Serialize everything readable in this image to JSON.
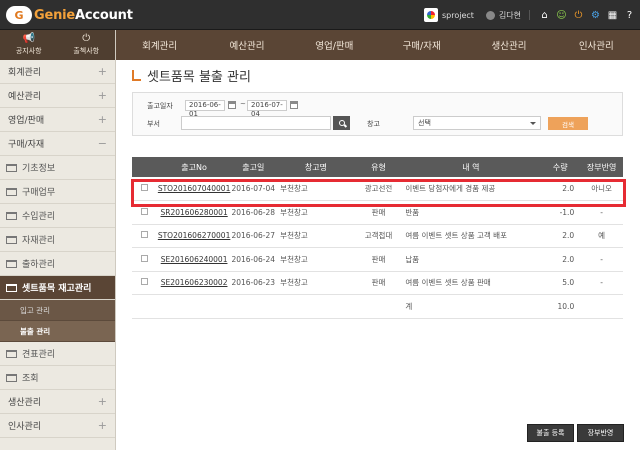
{
  "app": {
    "logo_mark": "G",
    "logo_prefix": "Genie",
    "logo_suffix": "Account"
  },
  "topbar": {
    "company": "sproject",
    "user": "김다현",
    "icons": [
      "home-icon",
      "user-icon",
      "power-icon",
      "gear-icon",
      "calendar-icon",
      "help-icon"
    ]
  },
  "sidebar": {
    "top_buttons": [
      {
        "label": "공지사항",
        "icon": "megaphone-icon"
      },
      {
        "label": "출첵사항",
        "icon": "power-icon"
      }
    ],
    "menu": [
      {
        "label": "회계관리",
        "toggle": "+"
      },
      {
        "label": "예산관리",
        "toggle": "+"
      },
      {
        "label": "영업/판매",
        "toggle": "+"
      },
      {
        "label": "구매/자재",
        "toggle": "−"
      }
    ],
    "submenu": [
      "기초정보",
      "구매업무",
      "수입관리",
      "자재관리",
      "출하관리"
    ],
    "active_submenu": "셋트품목 재고관리",
    "leaves": [
      "입고 관리",
      "불출 관리"
    ],
    "submenu_after": [
      "견표관리",
      "조회"
    ],
    "menu_after": [
      {
        "label": "생산관리",
        "toggle": "+"
      },
      {
        "label": "인사관리",
        "toggle": "+"
      }
    ]
  },
  "topnav": [
    "회계관리",
    "예산관리",
    "영업/판매",
    "구매/자재",
    "생산관리",
    "인사관리"
  ],
  "page": {
    "title": "셋트품목 불출 관리"
  },
  "search": {
    "date_label": "출고일자",
    "date_from": "2016-06-01",
    "date_sep": "~",
    "date_to": "2016-07-04",
    "dept_label": "부서",
    "dept_value": "",
    "warehouse_label": "창고",
    "warehouse_value": "선택",
    "search_button": "검색"
  },
  "table": {
    "headers": [
      "",
      "출고No",
      "출고일",
      "창고명",
      "유형",
      "내 역",
      "수량",
      "장부반영"
    ],
    "rows": [
      {
        "no": "STO201607040001",
        "date": "2016-07-04",
        "warehouse": "부천창고",
        "type": "광고선전",
        "desc": "이벤트 당첨자에게 경품 제공",
        "qty": "2.0",
        "posted": "아니오"
      },
      {
        "no": "SR201606280001",
        "date": "2016-06-28",
        "warehouse": "부천창고",
        "type": "판매",
        "desc": "반품",
        "qty": "-1.0",
        "posted": "-"
      },
      {
        "no": "STO201606270001",
        "date": "2016-06-27",
        "warehouse": "부천창고",
        "type": "고객접대",
        "desc": "여름 이벤트 셋트 상품 고객 배포",
        "qty": "2.0",
        "posted": "예"
      },
      {
        "no": "SE201606240001",
        "date": "2016-06-24",
        "warehouse": "부천창고",
        "type": "판매",
        "desc": "납품",
        "qty": "2.0",
        "posted": "-"
      },
      {
        "no": "SE201606230002",
        "date": "2016-06-23",
        "warehouse": "부천창고",
        "type": "판매",
        "desc": "여름 이벤트 셋트 상품 판매",
        "qty": "5.0",
        "posted": "-"
      }
    ],
    "total_label": "계",
    "total_qty": "10.0"
  },
  "actions": {
    "release_register": "불출 등록",
    "ledger_post": "장부반영"
  }
}
